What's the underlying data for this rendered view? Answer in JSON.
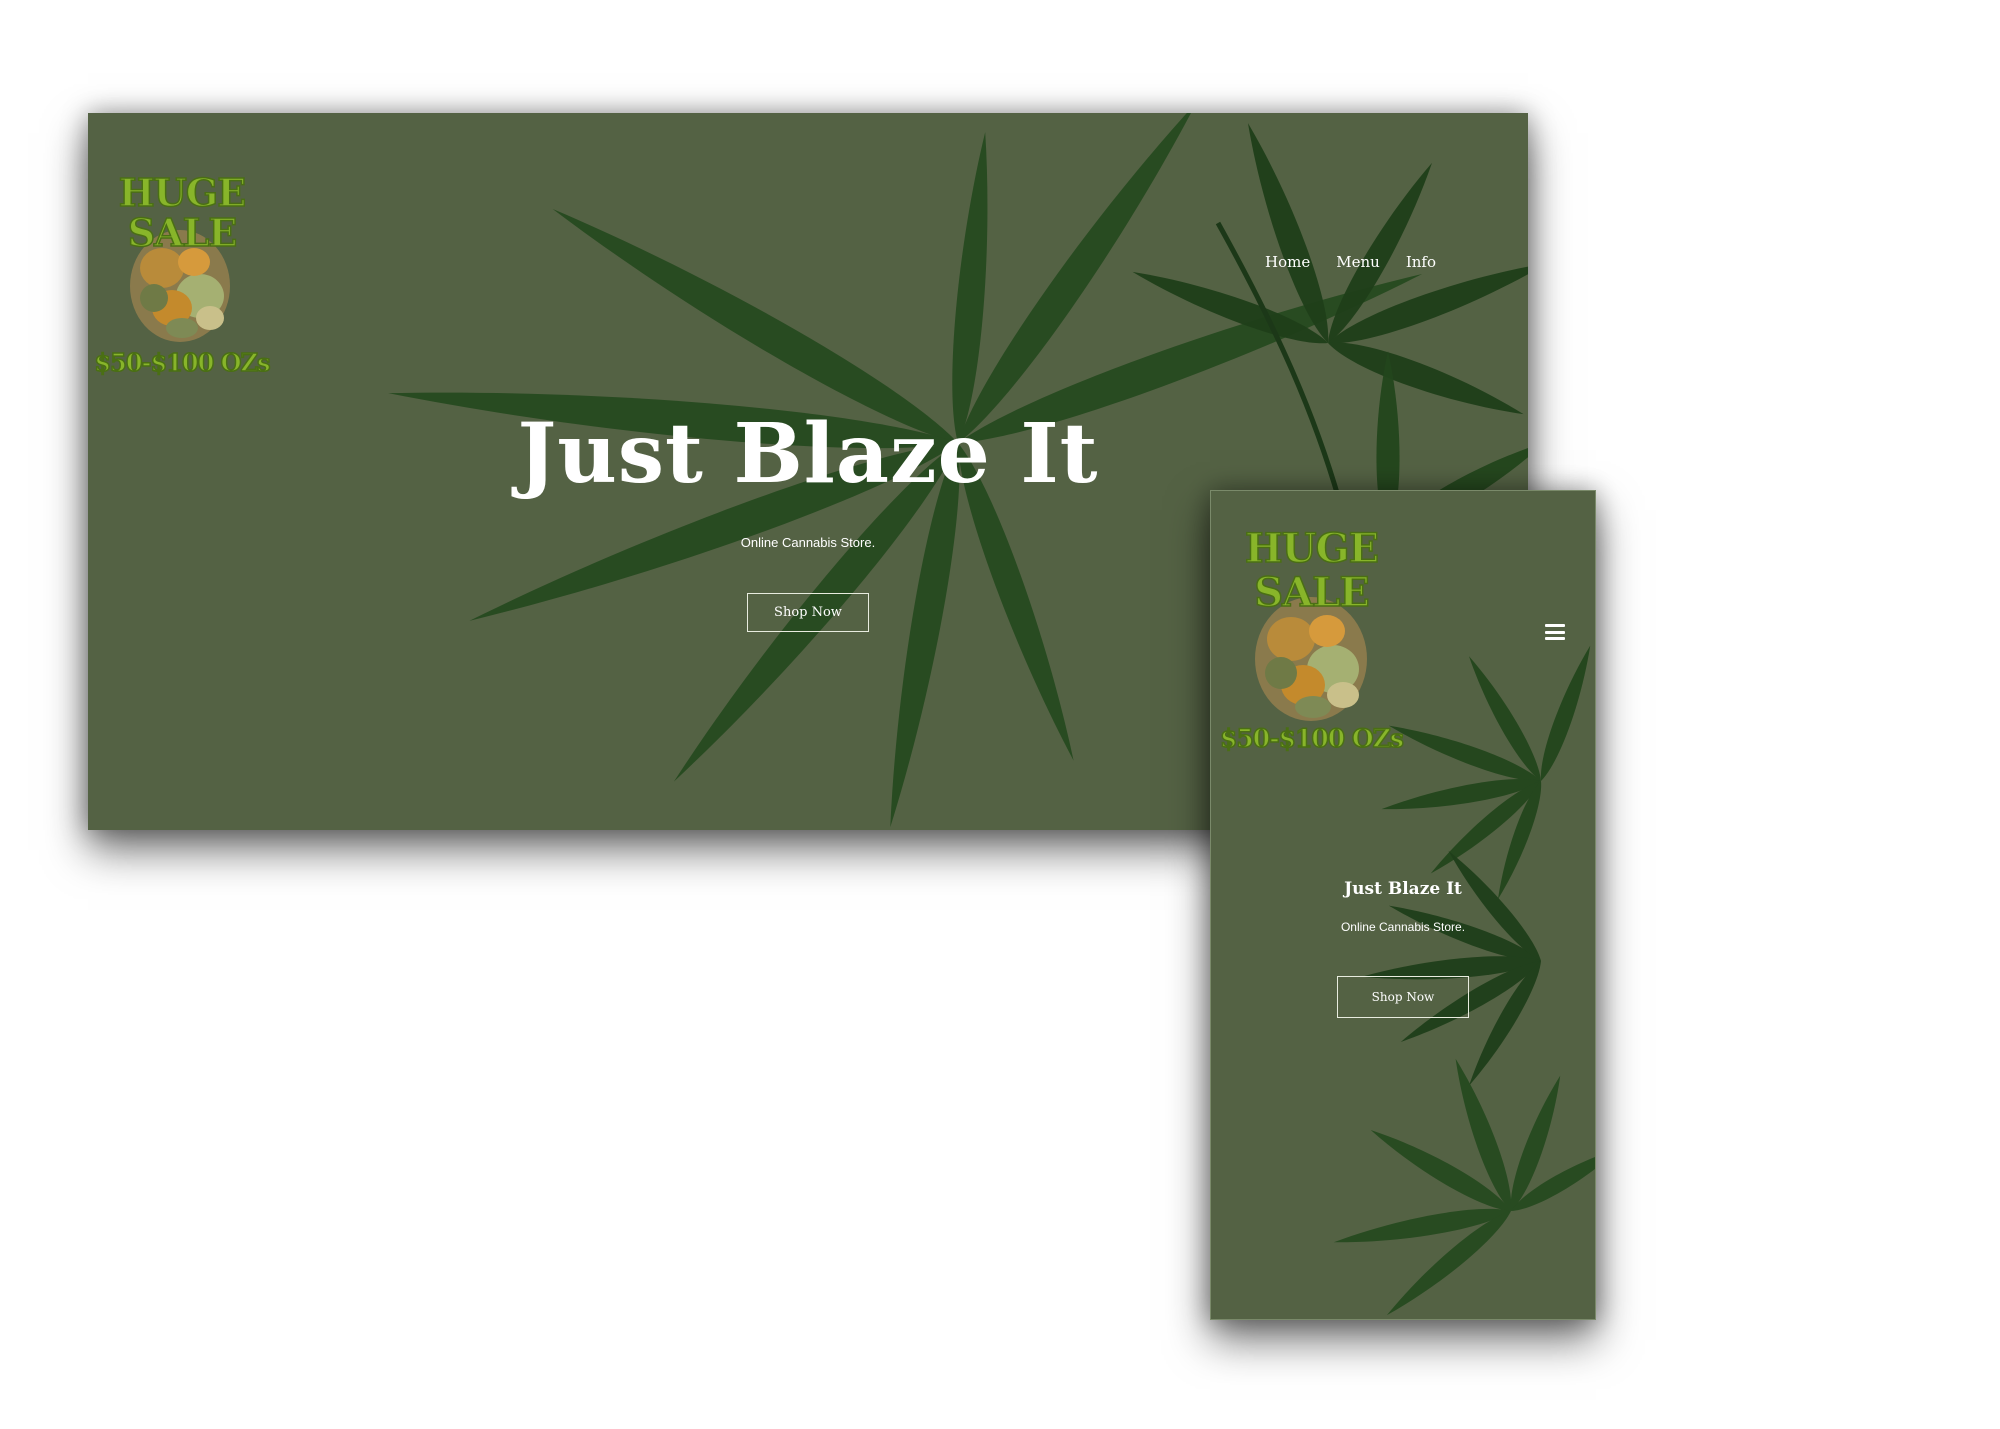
{
  "desktop": {
    "logo": {
      "line1": "HUGE",
      "line2": "SALE",
      "price": "$50-$100 OZs"
    },
    "nav": {
      "home": "Home",
      "menu": "Menu",
      "info": "Info"
    },
    "hero": {
      "title": "Just Blaze It",
      "subtitle": "Online Cannabis Store.",
      "button": "Shop Now"
    }
  },
  "mobile": {
    "logo": {
      "line1": "HUGE",
      "line2": "SALE",
      "price": "$50-$100 OZs"
    },
    "menu_icon": "hamburger-menu-icon",
    "hero": {
      "title": "Just Blaze It",
      "subtitle": "Online Cannabis Store.",
      "button": "Shop Now"
    }
  },
  "colors": {
    "background": "#546244",
    "leaf_dark": "#1f3f1a",
    "leaf_mid": "#2c5124",
    "logo_green": "#88b52a"
  }
}
